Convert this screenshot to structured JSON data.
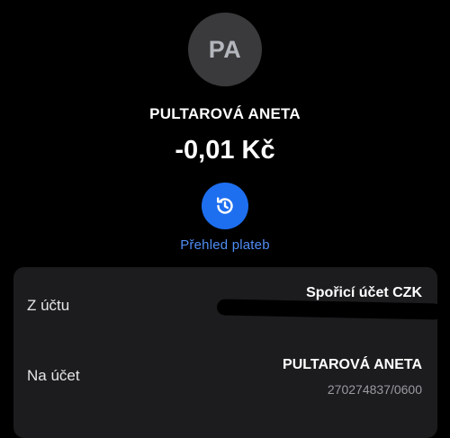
{
  "avatar": {
    "initials": "PA"
  },
  "payment": {
    "payee_name": "PULTAROVÁ ANETA",
    "amount": "-0,01 Kč"
  },
  "actions": {
    "history_icon": "history-icon",
    "history_label": "Přehled plateb"
  },
  "details": {
    "from": {
      "label": "Z účtu",
      "account_name": "Spořicí účet CZK"
    },
    "to": {
      "label": "Na účet",
      "account_name": "PULTAROVÁ ANETA",
      "account_number": "270274837/0600"
    }
  },
  "colors": {
    "background": "#000000",
    "avatar_bg": "#3a3a3c",
    "accent": "#1e6ff0",
    "link": "#4f8df5",
    "card_bg": "#1c1c1e"
  }
}
